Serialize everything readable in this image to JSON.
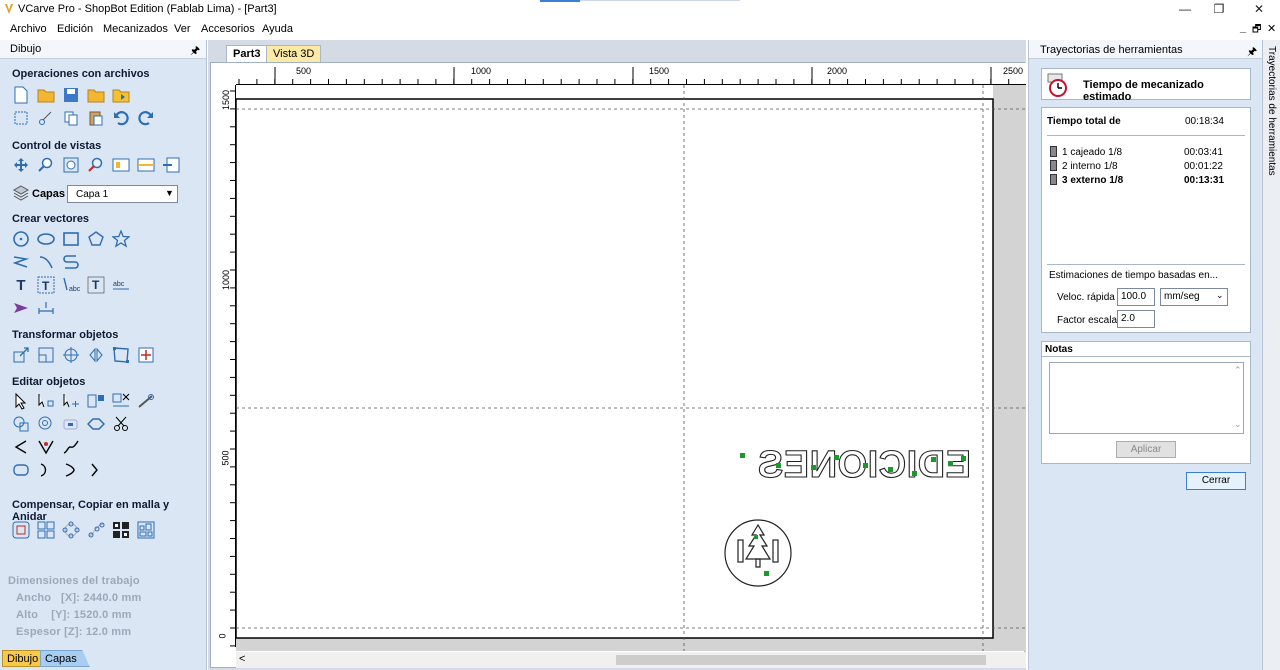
{
  "window": {
    "title": "VCarve Pro - ShopBot Edition (Fablab Lima) - [Part3]",
    "minimize": "—",
    "maximize": "❐",
    "close": "✕"
  },
  "menu": {
    "items": [
      "Archivo",
      "Edición",
      "Mecanizados",
      "Ver",
      "Accesorios",
      "Ayuda"
    ],
    "mdi_min": "_",
    "mdi_restore": "🗗",
    "mdi_close": "✕"
  },
  "left_panel": {
    "title": "Dibujo",
    "pin": "🖈",
    "sections": {
      "file_ops": "Operaciones con archivos",
      "view_control": "Control de vistas",
      "create_vectors": "Crear vectores",
      "transform": "Transformar objetos",
      "edit": "Editar objetos",
      "offset": "Compensar, Copiar en malla y Anidar"
    },
    "layers_label": "Capas",
    "layer_value": "Capa 1",
    "job_dims": {
      "title": "Dimensiones del trabajo",
      "width": "Ancho   [X]: 2440.0 mm",
      "height": "Alto    [Y]: 1520.0 mm",
      "thickness": "Espesor [Z]: 12.0 mm"
    },
    "bottom_tabs": [
      "Dibujo",
      "Capas"
    ]
  },
  "document": {
    "tabs": [
      "Part3",
      "Vista 3D"
    ],
    "active_tab": "Part3",
    "hruler_labels": [
      "500",
      "1000",
      "1500",
      "2000",
      "2500"
    ],
    "vruler_labels": [
      "1500",
      "1000",
      "500",
      "0"
    ],
    "design_text": "EDICIONES",
    "scroll_left": "<"
  },
  "right_panel": {
    "title": "Trayectorias de herramientas",
    "pin": "🖈",
    "header_title": "Tiempo de mecanizado estimado",
    "total_label": "Tiempo total de",
    "total_value": "00:18:34",
    "toolpaths": [
      {
        "name": "1 cajeado 1/8",
        "time": "00:03:41",
        "bold": false
      },
      {
        "name": "2 interno 1/8",
        "time": "00:01:22",
        "bold": false
      },
      {
        "name": "3 externo 1/8",
        "time": "00:13:31",
        "bold": true
      }
    ],
    "estimates_label": "Estimaciones de tiempo basadas en...",
    "rapid_label": "Veloc. rápida",
    "rapid_value": "100.0",
    "rapid_unit": "mm/seg",
    "scale_label": "Factor escala",
    "scale_value": "2.0",
    "notes_label": "Notas",
    "notes_value": "",
    "apply_label": "Aplicar",
    "close_label": "Cerrar",
    "side_tab": "Trayectorias de herramientas"
  }
}
